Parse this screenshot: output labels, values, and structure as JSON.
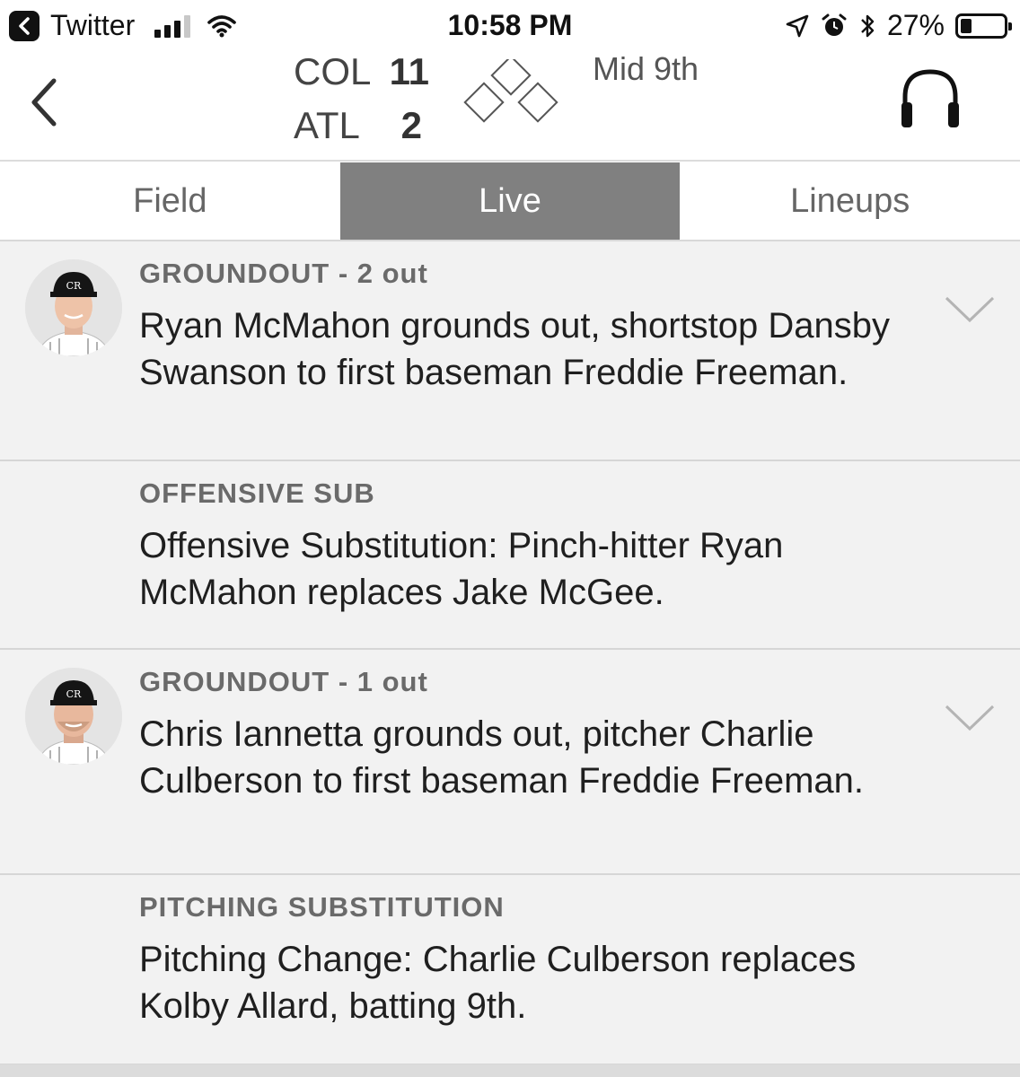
{
  "status_bar": {
    "back_app": "Twitter",
    "time": "10:58 PM",
    "battery_percent": "27%",
    "battery_level": 0.27
  },
  "game": {
    "away_team": "COL",
    "away_score": "11",
    "home_team": "ATL",
    "home_score": "2",
    "inning": "Mid 9th"
  },
  "tabs": [
    {
      "label": "Field",
      "active": false
    },
    {
      "label": "Live",
      "active": true
    },
    {
      "label": "Lineups",
      "active": false
    }
  ],
  "plays": [
    {
      "type": "GROUNDOUT - 2 out",
      "description": "Ryan McMahon grounds out, shortstop Dansby Swanson to first baseman Freddie Freeman.",
      "has_avatar": true,
      "expandable": true
    },
    {
      "type": "OFFENSIVE SUB",
      "description": "Offensive Substitution: Pinch-hitter Ryan McMahon replaces Jake McGee.",
      "has_avatar": false,
      "expandable": false
    },
    {
      "type": "GROUNDOUT - 1 out",
      "description": "Chris Iannetta grounds out, pitcher Charlie Culberson to first baseman Freddie Freeman.",
      "has_avatar": true,
      "expandable": true
    },
    {
      "type": "PITCHING SUBSTITUTION",
      "description": "Pitching Change: Charlie Culberson replaces Kolby Allard, batting 9th.",
      "has_avatar": false,
      "expandable": false
    }
  ],
  "icons": {
    "status_bar": [
      "back-to-app-icon",
      "cellular-signal-icon",
      "wifi-icon",
      "location-arrow-icon",
      "alarm-icon",
      "bluetooth-icon",
      "battery-icon"
    ],
    "header": [
      "back-chevron-icon",
      "bases-diamond-icon",
      "headphones-icon"
    ],
    "play": [
      "player-headshot",
      "chevron-down-icon"
    ]
  }
}
